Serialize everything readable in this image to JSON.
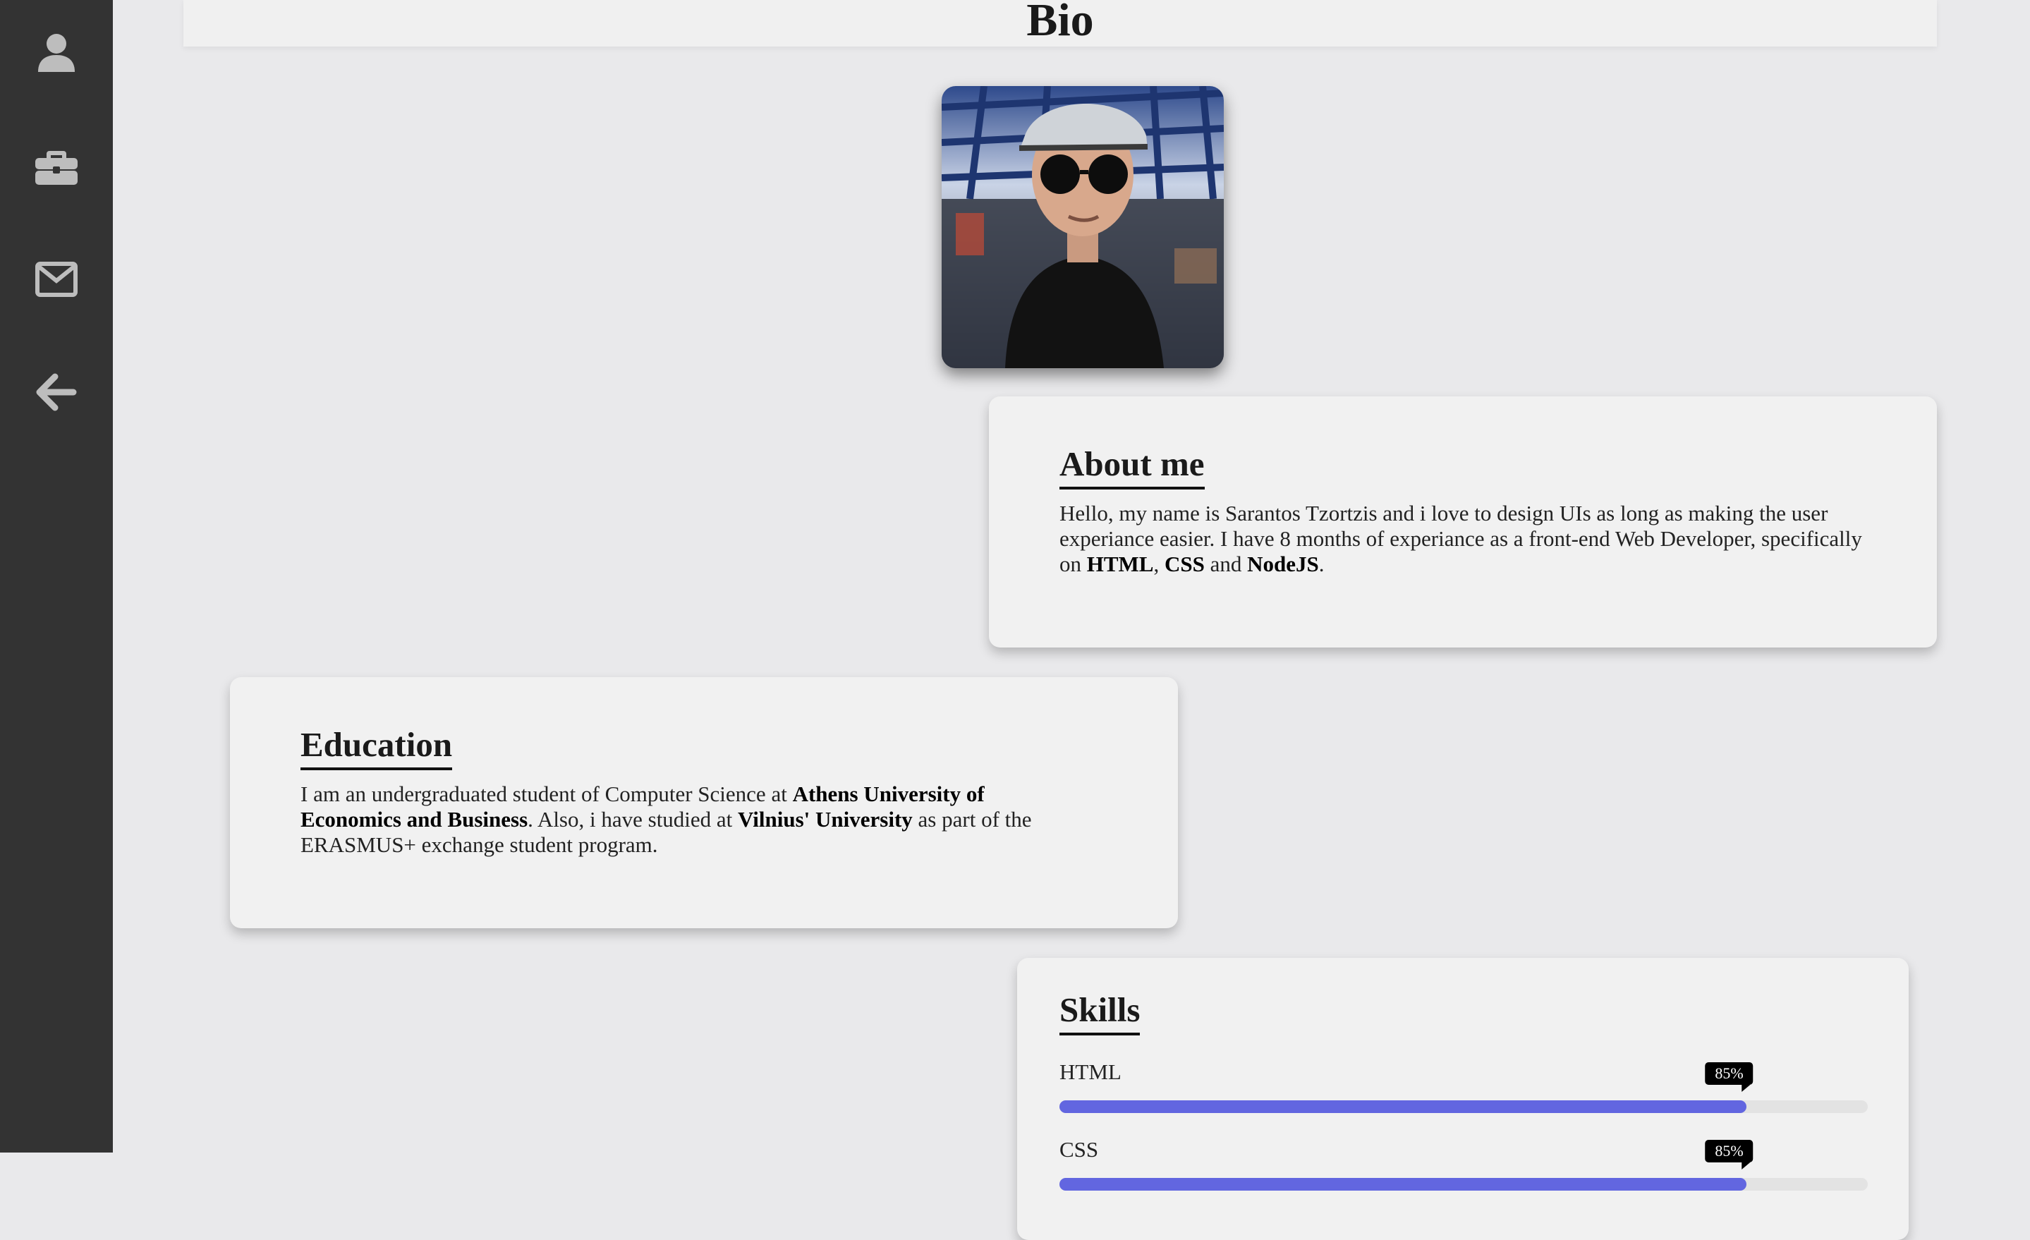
{
  "sidebar": {
    "items": [
      {
        "icon": "user-icon"
      },
      {
        "icon": "briefcase-icon"
      },
      {
        "icon": "envelope-icon"
      },
      {
        "icon": "arrow-left-icon"
      }
    ]
  },
  "header": {
    "title": "Bio"
  },
  "about": {
    "title": "About me",
    "text_1": "Hello, my name is Sarantos Tzortzis and i love to design UIs as long as making the user experiance easier. I have 8 months of experiance as a front-end Web Developer, specifically on ",
    "bold_1": "HTML",
    "text_2": ", ",
    "bold_2": "CSS",
    "text_3": " and ",
    "bold_3": "NodeJS",
    "text_4": "."
  },
  "education": {
    "title": "Education",
    "text_1": "I am an undergraduated student of Computer Science at ",
    "bold_1": "Athens University of Economics and Business",
    "text_2": ". Also, i have studied at ",
    "bold_2": "Vilnius' University",
    "text_3": " as part of the ERASMUS+ exchange student program."
  },
  "skills": {
    "title": "Skills",
    "items": [
      {
        "name": "HTML",
        "percent_label": "85%",
        "level": 0.85
      },
      {
        "name": "CSS",
        "percent_label": "85%",
        "level": 0.85
      }
    ]
  },
  "colors": {
    "sidebar": "#333333",
    "background": "#e9e9eb",
    "card": "#f1f1f1",
    "skill_fill": "#6266e0"
  }
}
